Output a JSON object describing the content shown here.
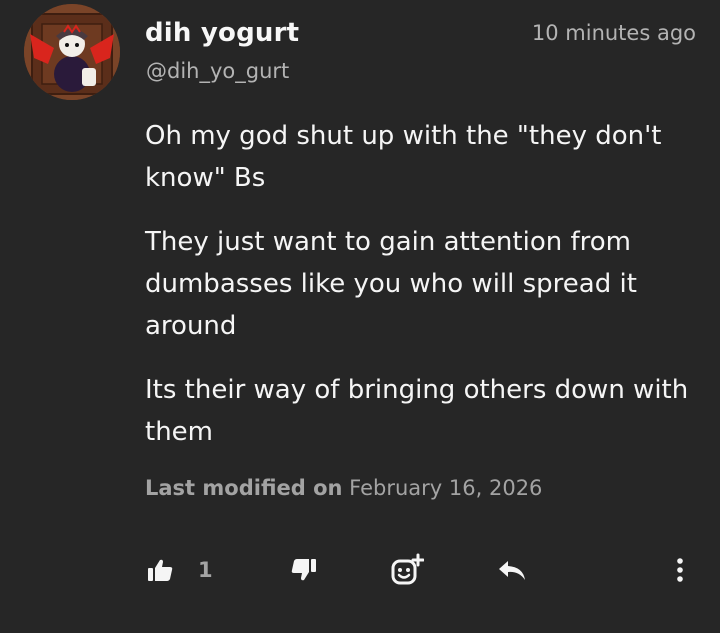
{
  "comment": {
    "author_display_name": "dih yogurt",
    "author_handle": "@dih_yo_gurt",
    "timestamp": "10 minutes ago",
    "paragraphs": [
      "Oh my god shut up with the \"they don't know\" Bs",
      "They just want to gain attention from dumbasses like you who will spread it around",
      "Its their way of bringing others down with them"
    ],
    "last_modified_label": "Last modified on",
    "last_modified_date": "February 16, 2026"
  },
  "actions": {
    "upvote_count": "1",
    "icons": [
      "thumbs-up-icon",
      "thumbs-down-icon",
      "add-reaction-icon",
      "reply-icon",
      "more-options-icon"
    ]
  },
  "colors": {
    "background": "#262626",
    "text_primary": "#f5f5f5",
    "text_secondary": "#b3b3b3",
    "avatar_accent": "#d9251d"
  }
}
